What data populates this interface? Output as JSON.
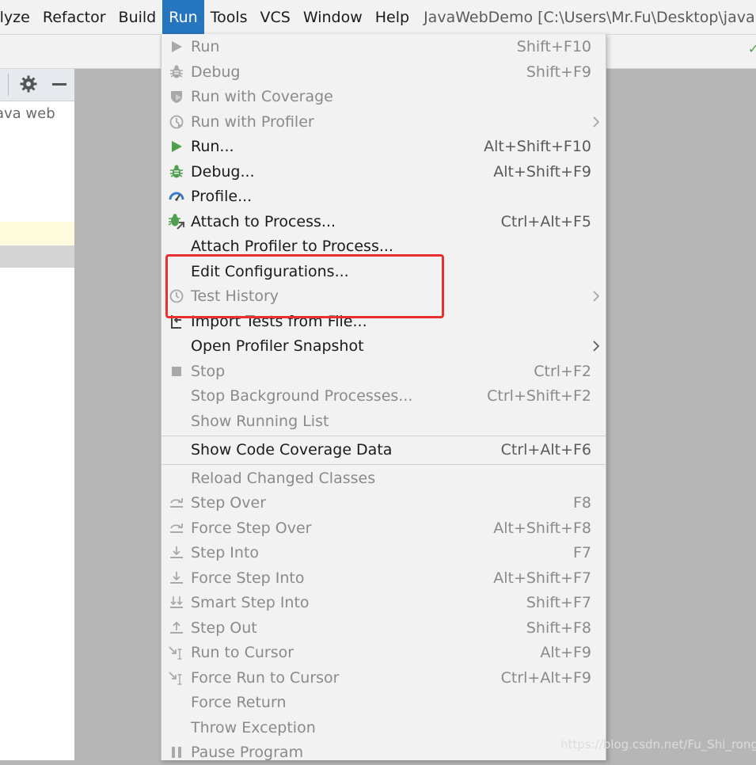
{
  "menubar": {
    "items": [
      "alyze",
      "Refactor",
      "Build",
      "Run",
      "Tools",
      "VCS",
      "Window",
      "Help"
    ],
    "active": "Run",
    "title": "JavaWebDemo [C:\\Users\\Mr.Fu\\Desktop\\java web"
  },
  "project_panel": {
    "label": "ava web"
  },
  "colors": {
    "accent": "#2675bf",
    "highlight_box": "#e8312f",
    "run_green": "#4f9d4f",
    "disabled_gray": "#8a8a8a"
  },
  "menu": {
    "items": [
      {
        "label": "Run",
        "shortcut": "Shift+F10",
        "icon": "play-icon",
        "disabled": true
      },
      {
        "label": "Debug",
        "shortcut": "Shift+F9",
        "icon": "bug-icon",
        "disabled": true
      },
      {
        "label": "Run with Coverage",
        "shortcut": "",
        "icon": "coverage-shield-icon",
        "disabled": true
      },
      {
        "label": "Run with Profiler",
        "shortcut": "",
        "icon": "profiler-icon",
        "disabled": true,
        "submenu": true
      },
      {
        "label": "Run...",
        "shortcut": "Alt+Shift+F10",
        "icon": "play-icon",
        "disabled": false
      },
      {
        "label": "Debug...",
        "shortcut": "Alt+Shift+F9",
        "icon": "bug-icon",
        "disabled": false
      },
      {
        "label": "Profile...",
        "shortcut": "",
        "icon": "gauge-icon",
        "disabled": false
      },
      {
        "label": "Attach to Process...",
        "shortcut": "Ctrl+Alt+F5",
        "icon": "attach-bug-icon",
        "disabled": false
      },
      {
        "label": "Attach Profiler to Process...",
        "shortcut": "",
        "icon": "",
        "disabled": false
      },
      {
        "label": "Edit Configurations...",
        "shortcut": "",
        "icon": "",
        "disabled": false
      },
      {
        "label": "Test History",
        "shortcut": "",
        "icon": "history-clock-icon",
        "disabled": true,
        "submenu": true
      },
      {
        "label": "Import Tests from File...",
        "shortcut": "",
        "icon": "import-icon",
        "disabled": false
      },
      {
        "label": "Open Profiler Snapshot",
        "shortcut": "",
        "icon": "",
        "disabled": false,
        "submenu": true
      },
      {
        "label": "Stop",
        "shortcut": "Ctrl+F2",
        "icon": "stop-square-icon",
        "disabled": true
      },
      {
        "label": "Stop Background Processes...",
        "shortcut": "Ctrl+Shift+F2",
        "icon": "",
        "disabled": true
      },
      {
        "label": "Show Running List",
        "shortcut": "",
        "icon": "",
        "disabled": true
      },
      {
        "label": "Show Code Coverage Data",
        "shortcut": "Ctrl+Alt+F6",
        "icon": "",
        "disabled": false
      },
      {
        "label": "Reload Changed Classes",
        "shortcut": "",
        "icon": "",
        "disabled": true
      },
      {
        "label": "Step Over",
        "shortcut": "F8",
        "icon": "step-over-icon",
        "disabled": true
      },
      {
        "label": "Force Step Over",
        "shortcut": "Alt+Shift+F8",
        "icon": "step-over-icon",
        "disabled": true
      },
      {
        "label": "Step Into",
        "shortcut": "F7",
        "icon": "step-into-icon",
        "disabled": true
      },
      {
        "label": "Force Step Into",
        "shortcut": "Alt+Shift+F7",
        "icon": "step-into-icon",
        "disabled": true
      },
      {
        "label": "Smart Step Into",
        "shortcut": "Shift+F7",
        "icon": "smart-step-into-icon",
        "disabled": true
      },
      {
        "label": "Step Out",
        "shortcut": "Shift+F8",
        "icon": "step-out-icon",
        "disabled": true
      },
      {
        "label": "Run to Cursor",
        "shortcut": "Alt+F9",
        "icon": "run-to-cursor-icon",
        "disabled": true
      },
      {
        "label": "Force Run to Cursor",
        "shortcut": "Ctrl+Alt+F9",
        "icon": "run-to-cursor-icon",
        "disabled": true
      },
      {
        "label": "Force Return",
        "shortcut": "",
        "icon": "",
        "disabled": true
      },
      {
        "label": "Throw Exception",
        "shortcut": "",
        "icon": "",
        "disabled": true
      },
      {
        "label": "Pause Program",
        "shortcut": "",
        "icon": "pause-icon",
        "disabled": true
      }
    ]
  },
  "watermark": "https://blog.csdn.net/Fu_Shi_rong"
}
